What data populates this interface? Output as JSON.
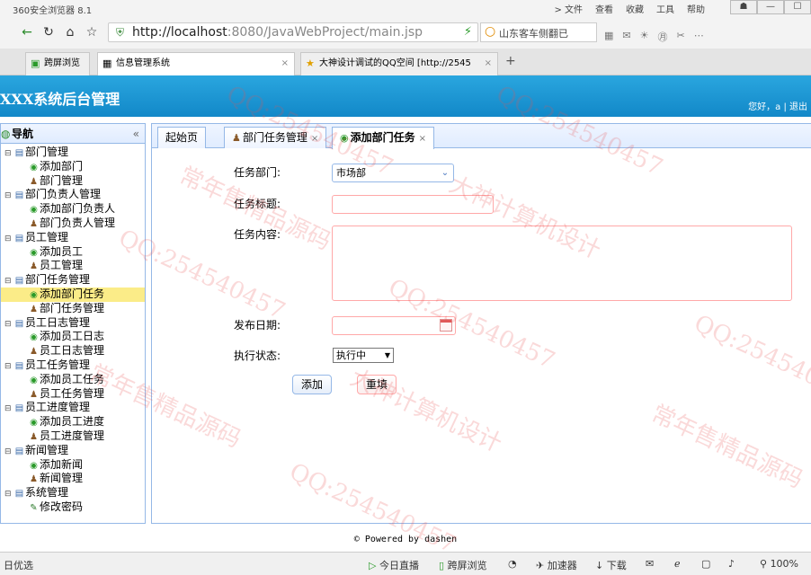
{
  "browser": {
    "title": "360安全浏览器 8.1",
    "menu": [
      "> 文件",
      "查看",
      "收藏",
      "工具",
      "帮助"
    ],
    "win_controls": [
      "☗",
      "—",
      "☐"
    ],
    "url_host": "http://localhost",
    "url_rest": ":8080/JavaWebProject/main.jsp",
    "search_value": "山东客车侧翻已",
    "tabs": [
      {
        "label": "跨屏浏览",
        "icon": "▣"
      },
      {
        "label": "信息管理系统",
        "icon": "▦"
      },
      {
        "label": "大神设计调试的QQ空间 [http://2545",
        "icon": "★"
      }
    ],
    "new_tab": "+"
  },
  "app": {
    "title": "XXX系统后台管理",
    "greeting": "您好，a",
    "separator": "|",
    "logout": "退出"
  },
  "nav": {
    "title": "导航",
    "collapse": "«",
    "groups": [
      {
        "label": "部门管理",
        "items": [
          {
            "label": "添加部门",
            "icon": "add"
          },
          {
            "label": "部门管理",
            "icon": "user"
          }
        ]
      },
      {
        "label": "部门负责人管理",
        "items": [
          {
            "label": "添加部门负责人",
            "icon": "add"
          },
          {
            "label": "部门负责人管理",
            "icon": "user"
          }
        ]
      },
      {
        "label": "员工管理",
        "items": [
          {
            "label": "添加员工",
            "icon": "add"
          },
          {
            "label": "员工管理",
            "icon": "user"
          }
        ]
      },
      {
        "label": "部门任务管理",
        "items": [
          {
            "label": "添加部门任务",
            "icon": "add",
            "selected": true
          },
          {
            "label": "部门任务管理",
            "icon": "user"
          }
        ]
      },
      {
        "label": "员工日志管理",
        "items": [
          {
            "label": "添加员工日志",
            "icon": "add"
          },
          {
            "label": "员工日志管理",
            "icon": "user"
          }
        ]
      },
      {
        "label": "员工任务管理",
        "items": [
          {
            "label": "添加员工任务",
            "icon": "add"
          },
          {
            "label": "员工任务管理",
            "icon": "user"
          }
        ]
      },
      {
        "label": "员工进度管理",
        "items": [
          {
            "label": "添加员工进度",
            "icon": "add"
          },
          {
            "label": "员工进度管理",
            "icon": "user"
          }
        ]
      },
      {
        "label": "新闻管理",
        "items": [
          {
            "label": "添加新闻",
            "icon": "add"
          },
          {
            "label": "新闻管理",
            "icon": "user"
          }
        ]
      },
      {
        "label": "系统管理",
        "items": [
          {
            "label": "修改密码",
            "icon": "pen"
          }
        ]
      }
    ]
  },
  "main_tabs": [
    {
      "label": "起始页",
      "closable": false
    },
    {
      "label": "部门任务管理",
      "closable": true,
      "close": "×",
      "icon": "user"
    },
    {
      "label": "添加部门任务",
      "closable": true,
      "close": "×",
      "icon": "add",
      "active": true
    }
  ],
  "form": {
    "dept_label": "任务部门:",
    "dept_value": "市场部",
    "title_label": "任务标题:",
    "title_value": "",
    "content_label": "任务内容:",
    "content_value": "",
    "date_label": "发布日期:",
    "date_value": "",
    "status_label": "执行状态:",
    "status_value": "执行中",
    "add_button": "添加",
    "reset_button": "重填"
  },
  "footer": "© Powered by dashen",
  "statusbar": {
    "left": "日优选",
    "items": [
      "今日直播",
      "跨屏浏览",
      "加速器",
      "下载"
    ],
    "zoom": "100%"
  },
  "watermarks": [
    "常年售精品源码",
    "QQ:254540457",
    "大神计算机设计"
  ],
  "colors": {
    "header": "#1b95d4",
    "selected": "#fbec88",
    "border": "#95b8e7"
  }
}
